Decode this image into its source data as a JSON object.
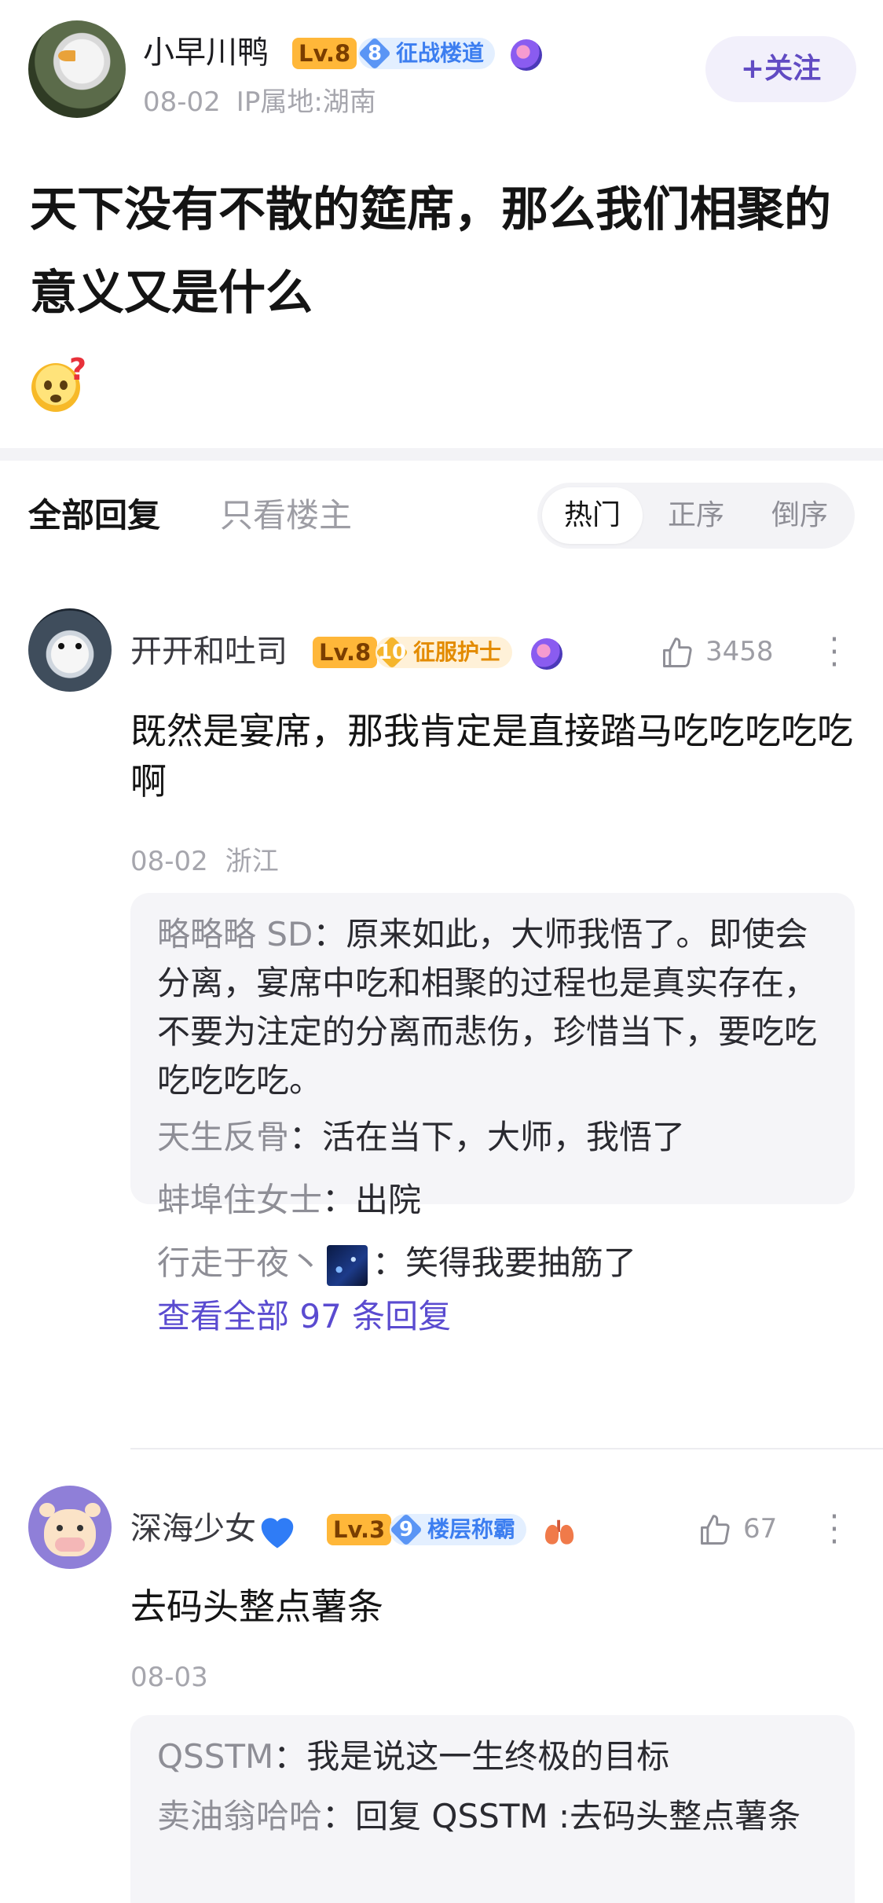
{
  "post": {
    "author": {
      "name": "小早川鸭",
      "level": "Lv.8",
      "badge_num": "8",
      "badge_title": "征战楼道"
    },
    "date": "08-02",
    "ip_location": "IP属地:湖南",
    "follow_label": "+关注",
    "title": "天下没有不散的筵席，那么我们相聚的意义又是什么"
  },
  "tabs": {
    "all_replies": "全部回复",
    "op_only": "只看楼主"
  },
  "sort": {
    "hot": "热门",
    "asc": "正序",
    "desc": "倒序",
    "selected": "热门"
  },
  "comments": [
    {
      "name": "开开和吐司",
      "level": "Lv.8",
      "badge_num": "10",
      "badge_title": "征服护士",
      "likes": "3458",
      "text": "既然是宴席，那我肯定是直接踏马吃吃吃吃吃啊",
      "date": "08-02",
      "location": "浙江",
      "replies": [
        {
          "name": "略略略 SD",
          "text": "原来如此，大师我悟了。即使会分离，宴席中吃和相聚的过程也是真实存在，不要为注定的分离而悲伤，珍惜当下，要吃吃吃吃吃吃。"
        },
        {
          "name": "天生反骨",
          "text": "活在当下，大师，我悟了"
        },
        {
          "name": "蚌埠住女士",
          "text": "出院"
        },
        {
          "name": "行走于夜丶",
          "text": "笑得我要抽筋了"
        }
      ],
      "view_all": "查看全部 97 条回复"
    },
    {
      "name": "深海少女",
      "level": "Lv.3",
      "badge_num": "9",
      "badge_title": "楼层称霸",
      "likes": "67",
      "text": "去码头整点薯条",
      "date": "08-03",
      "replies": [
        {
          "name": "QSSTM",
          "text": "我是说这一生终极的目标"
        },
        {
          "name": "卖油翁哈哈",
          "text": "回复 QSSTM :去码头整点薯条"
        }
      ]
    }
  ],
  "colors": {
    "accent": "#614bc3",
    "link": "#5a4bd0",
    "muted": "#a6a6ad",
    "level_badge": "#ffb739"
  }
}
